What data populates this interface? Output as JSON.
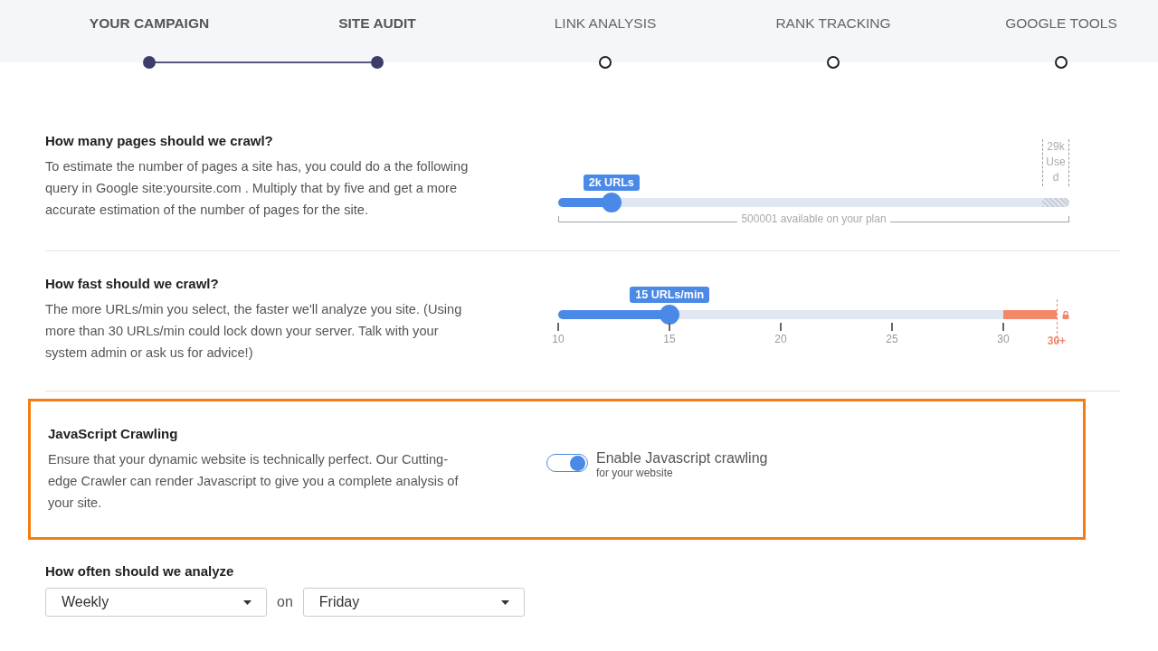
{
  "steps": [
    {
      "label": "YOUR CAMPAIGN",
      "done": true
    },
    {
      "label": "SITE AUDIT",
      "done": true
    },
    {
      "label": "LINK ANALYSIS",
      "done": false
    },
    {
      "label": "RANK TRACKING",
      "done": false
    },
    {
      "label": "GOOGLE TOOLS",
      "done": false
    }
  ],
  "pages": {
    "title": "How many pages should we crawl?",
    "text": "To estimate the number of pages a site has, you could do a the following query in Google site:yoursite.com . Multiply that by five and get a more accurate estimation of the number of pages for the site.",
    "bubble": "2k URLs",
    "level": 0.104,
    "used": [
      "29k",
      "Use",
      "d"
    ],
    "available": "500001 available on your plan"
  },
  "speed": {
    "title": "How fast should we crawl?",
    "text": "The more URLs/min you select, the faster we'll analyze you site. (Using more than 30 URLs/min could lock down your server. Talk with your system admin or ask us for advice!)",
    "bubble": "15 URLs/min",
    "level": 0.218,
    "ticks": [
      "10",
      "15",
      "20",
      "25",
      "30"
    ],
    "locked_tick": "30+"
  },
  "javascript": {
    "title": "JavaScript Crawling",
    "text": "Ensure that your dynamic website is technically perfect. Our Cutting-edge Crawler can render Javascript to give you a complete analysis of your site.",
    "on": true,
    "label": "Enable Javascript crawling",
    "sublabel": "for your website",
    "highlighted": true
  },
  "schedule": {
    "title": "How often should we analyze",
    "frequency": "Weekly",
    "joiner": "on",
    "day": "Friday"
  }
}
